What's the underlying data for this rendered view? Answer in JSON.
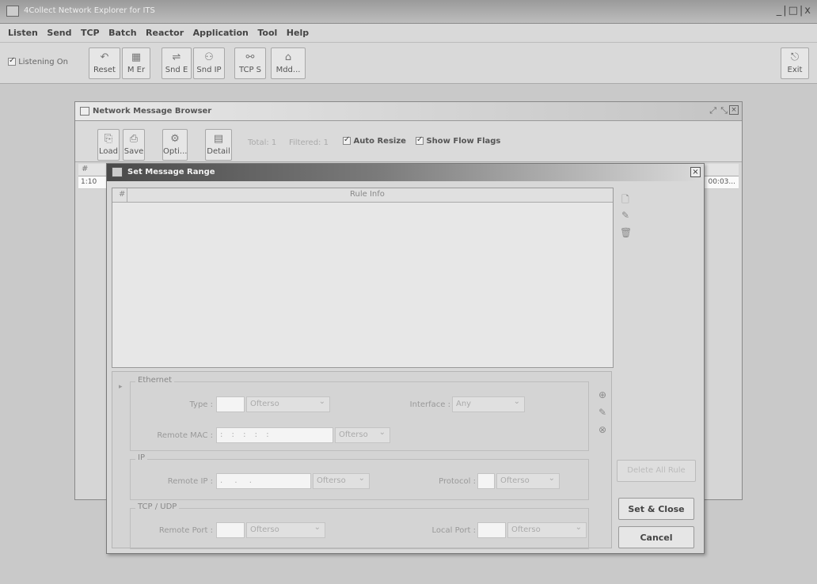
{
  "window": {
    "title": "4Collect Network Explorer for ITS",
    "controls": "_|□|x"
  },
  "menu": [
    "Listen",
    "Send",
    "TCP",
    "Batch",
    "Reactor",
    "Application",
    "Tool",
    "Help"
  ],
  "toolbar": {
    "listening_label": "Listening On",
    "buttons": [
      {
        "label": "Reset",
        "icon": "reset-icon"
      },
      {
        "label": "M Er",
        "icon": "grid-icon"
      },
      {
        "label": "Snd E",
        "icon": "send-ethernet-icon"
      },
      {
        "label": "Snd IP",
        "icon": "send-ip-icon"
      },
      {
        "label": "TCP S",
        "icon": "tcp-icon"
      },
      {
        "label": "Mdd...",
        "icon": "modem-icon"
      }
    ],
    "exit_label": "Exit"
  },
  "browser": {
    "title": "Network Message Browser",
    "buttons": [
      {
        "label": "Load",
        "icon": "load-icon"
      },
      {
        "label": "Save",
        "icon": "save-icon"
      },
      {
        "label": "Opti...",
        "icon": "options-icon"
      },
      {
        "label": "Detail",
        "icon": "detail-icon"
      }
    ],
    "total": "Total: 1",
    "filtered": "Filtered: 1",
    "auto_resize": "Auto Resize",
    "show_flow_flags": "Show Flow Flags",
    "col_hash": "#",
    "row_id": "1:10",
    "row_time": "00:03..."
  },
  "dialog": {
    "title": "Set Message Range",
    "table_col_hash": "#",
    "table_col_rule": "Rule Info",
    "ethernet": {
      "legend": "Ethernet",
      "type_label": "Type :",
      "type_select": "Ofterso",
      "interface_label": "Interface :",
      "interface_select": "Any",
      "remote_mac_label": "Remote MAC :",
      "mac_value": ":  :  :  :  :",
      "mac_select": "Ofterso"
    },
    "ip": {
      "legend": "IP",
      "remote_ip_label": "Remote IP :",
      "ip_value": ".  .  .",
      "ip_select": "Ofterso",
      "protocol_label": "Protocol :",
      "protocol_select": "Ofterso"
    },
    "tcpudp": {
      "legend": "TCP / UDP",
      "remote_port_label": "Remote Port :",
      "remote_port_select": "Ofterso",
      "local_port_label": "Local Port :",
      "local_port_select": "Ofterso"
    },
    "delete_all_label": "Delete All Rule",
    "set_close_label": "Set & Close",
    "cancel_label": "Cancel"
  }
}
